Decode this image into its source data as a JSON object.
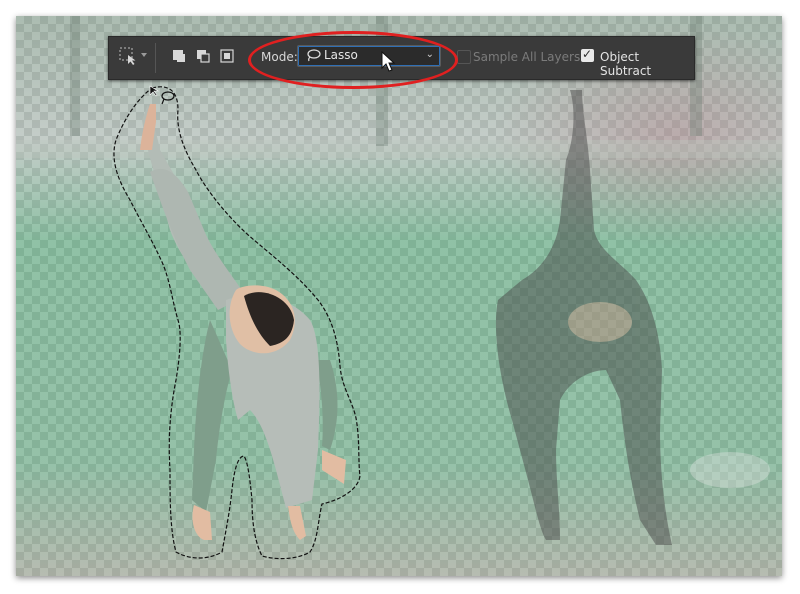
{
  "options_bar": {
    "tool_icon": "object-selection-tool-icon",
    "new_selection_icon": "new-selection-icon",
    "add_selection_icon": "add-to-selection-icon",
    "subtract_selection_icon": "subtract-from-selection-icon",
    "mode_label": "Mode:",
    "mode_value": "Lasso",
    "mode_icon": "lasso-icon",
    "mode_chevron": "⌄",
    "sample_all_layers_label": "Sample All Layers",
    "sample_all_layers_checked": false,
    "object_subtract_label": "Object Subtract",
    "object_subtract_checked": true
  },
  "colors": {
    "toolbar_bg": "#3a3a3a",
    "highlight": "#e02020",
    "selection_outline": "#111111"
  }
}
